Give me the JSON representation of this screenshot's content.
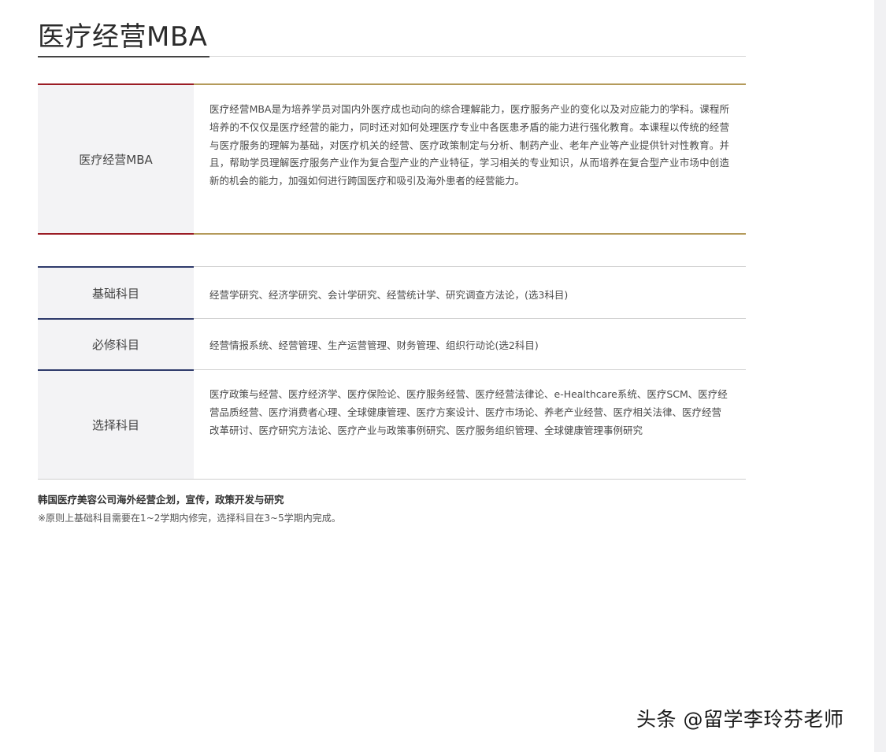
{
  "page": {
    "title": "医疗经营MBA"
  },
  "intro": {
    "label": "医疗经营MBA",
    "description": "医疗经营MBA是为培养学员对国内外医疗成也动向的综合理解能力，医疗服务产业的变化以及对应能力的学科。课程所培养的不仅仅是医疗经营的能力，同时还对如何处理医疗专业中各医患矛盾的能力进行强化教育。本课程以传统的经营与医疗服务的理解为基础，对医疗机关的经营、医疗政策制定与分析、制药产业、老年产业等产业提供针对性教育。并且，帮助学员理解医疗服务产业作为复合型产业的产业特征，学习相关的专业知识，从而培养在复合型产业市场中创造新的机会的能力，加强如何进行跨国医疗和吸引及海外患者的经营能力。"
  },
  "curriculum": [
    {
      "label": "基础科目",
      "content": "经营学研究、经济学研究、会计学研究、经营统计学、研究调查方法论，(选3科目)"
    },
    {
      "label": "必修科目",
      "content": "经营情报系统、经营管理、生产运营管理、财务管理、组织行动论(选2科目)"
    },
    {
      "label": "选择科目",
      "content": "医疗政策与经营、医疗经济学、医疗保险论、医疗服务经营、医疗经营法律论、e-Healthcare系统、医疗SCM、医疗经营品质经营、医疗消费者心理、全球健康管理、医疗方案设计、医疗市场论、养老产业经营、医疗相关法律、医疗经营改革研讨、医疗研究方法论、医疗产业与政策事例研究、医疗服务组织管理、全球健康管理事例研究"
    }
  ],
  "footnotes": {
    "bold": "韩国医疗美容公司海外经营企划，宣传，政策开发与研究",
    "note": "※原则上基础科目需要在1~2学期内修完，选择科目在3~5学期内完成。"
  },
  "watermark": "头条 @留学李玲芬老师",
  "colors": {
    "intro_accent_left": "#9b1c24",
    "intro_accent_right": "#b49a5a",
    "curriculum_accent": "#2e3a6b",
    "label_cell_bg": "#f3f3f5"
  }
}
